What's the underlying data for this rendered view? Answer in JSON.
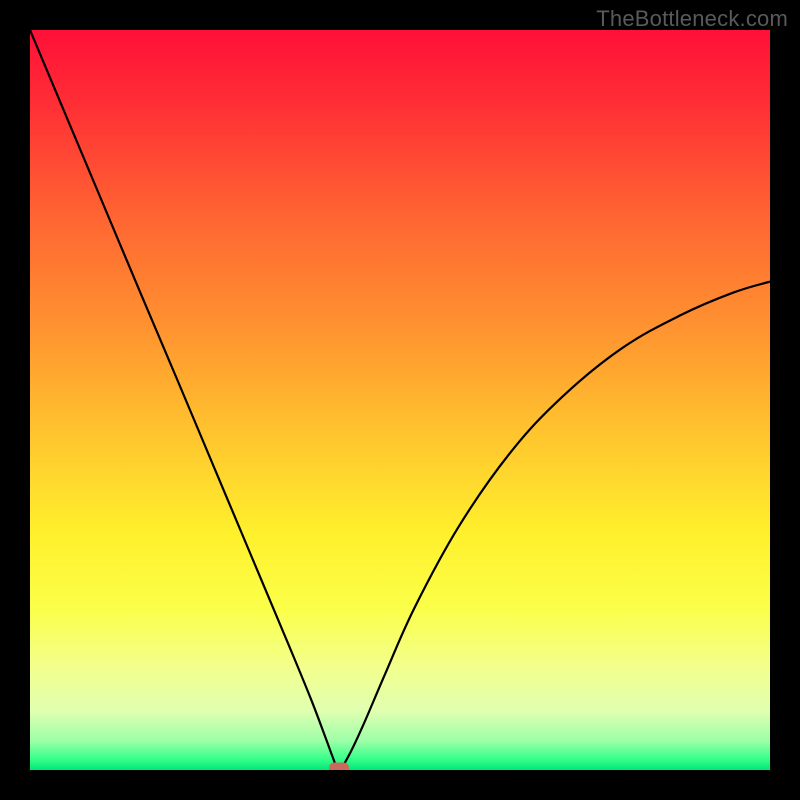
{
  "watermark": "TheBottleneck.com",
  "chart_data": {
    "type": "line",
    "title": "",
    "xlabel": "",
    "ylabel": "",
    "xlim": [
      0,
      100
    ],
    "ylim": [
      0,
      100
    ],
    "background": {
      "type": "gradient-vertical",
      "stops": [
        {
          "pos": 0.0,
          "color": "#ff1038"
        },
        {
          "pos": 0.1,
          "color": "#ff2e35"
        },
        {
          "pos": 0.25,
          "color": "#ff6432"
        },
        {
          "pos": 0.4,
          "color": "#ff9230"
        },
        {
          "pos": 0.55,
          "color": "#ffc62e"
        },
        {
          "pos": 0.68,
          "color": "#fff02c"
        },
        {
          "pos": 0.78,
          "color": "#fbff48"
        },
        {
          "pos": 0.86,
          "color": "#f3ff8c"
        },
        {
          "pos": 0.92,
          "color": "#e0ffb0"
        },
        {
          "pos": 0.96,
          "color": "#9effa8"
        },
        {
          "pos": 0.985,
          "color": "#38ff8a"
        },
        {
          "pos": 1.0,
          "color": "#00e878"
        }
      ]
    },
    "series": [
      {
        "name": "bottleneck-curve",
        "type": "line",
        "color": "#000000",
        "x": [
          0,
          5,
          10,
          15,
          20,
          25,
          30,
          35,
          38,
          40,
          41,
          41.7,
          43,
          45,
          48,
          52,
          58,
          65,
          72,
          80,
          88,
          95,
          100
        ],
        "y": [
          100,
          88.1,
          76.2,
          64.3,
          52.5,
          40.6,
          28.7,
          16.8,
          9.5,
          4.2,
          1.5,
          0.0,
          1.8,
          6.0,
          13.0,
          22.0,
          33.0,
          43.0,
          50.5,
          57.0,
          61.5,
          64.5,
          66.0
        ]
      }
    ],
    "annotations": [
      {
        "name": "minimum-marker",
        "shape": "rounded-rect",
        "x": 41.7,
        "y": 0.3,
        "color": "#c96a5c"
      }
    ]
  }
}
